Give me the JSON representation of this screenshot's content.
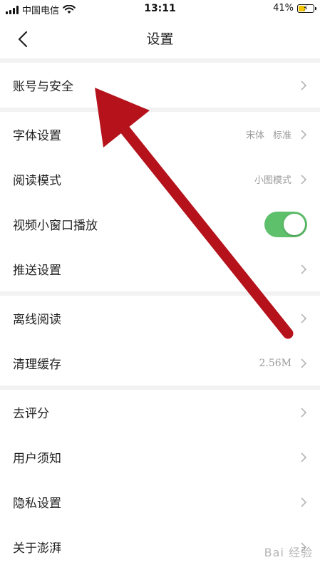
{
  "status_bar": {
    "carrier": "中国电信",
    "time": "13:11",
    "battery": "41%",
    "icons": [
      "signal-icon",
      "wifi-icon",
      "battery-icon"
    ]
  },
  "nav": {
    "title": "设置",
    "back_icon": "back-chevron-icon"
  },
  "groups": [
    {
      "items": [
        {
          "label": "账号与安全"
        }
      ]
    },
    {
      "items": [
        {
          "label": "字体设置",
          "value_a": "宋体",
          "value_b": "标准"
        },
        {
          "label": "阅读模式",
          "value": "小图模式"
        },
        {
          "label": "视频小窗口播放",
          "toggle": true
        },
        {
          "label": "推送设置"
        }
      ]
    },
    {
      "items": [
        {
          "label": "离线阅读"
        },
        {
          "label": "清理缓存",
          "value": "2.56M"
        }
      ]
    },
    {
      "items": [
        {
          "label": "去评分"
        },
        {
          "label": "用户须知"
        },
        {
          "label": "隐私设置"
        },
        {
          "label": "关于澎湃"
        }
      ]
    }
  ],
  "watermark": "Bai 经验",
  "colors": {
    "toggle_on": "#5ec06b",
    "annotation_arrow": "#b5121b",
    "group_separator": "#f2f2f2"
  }
}
